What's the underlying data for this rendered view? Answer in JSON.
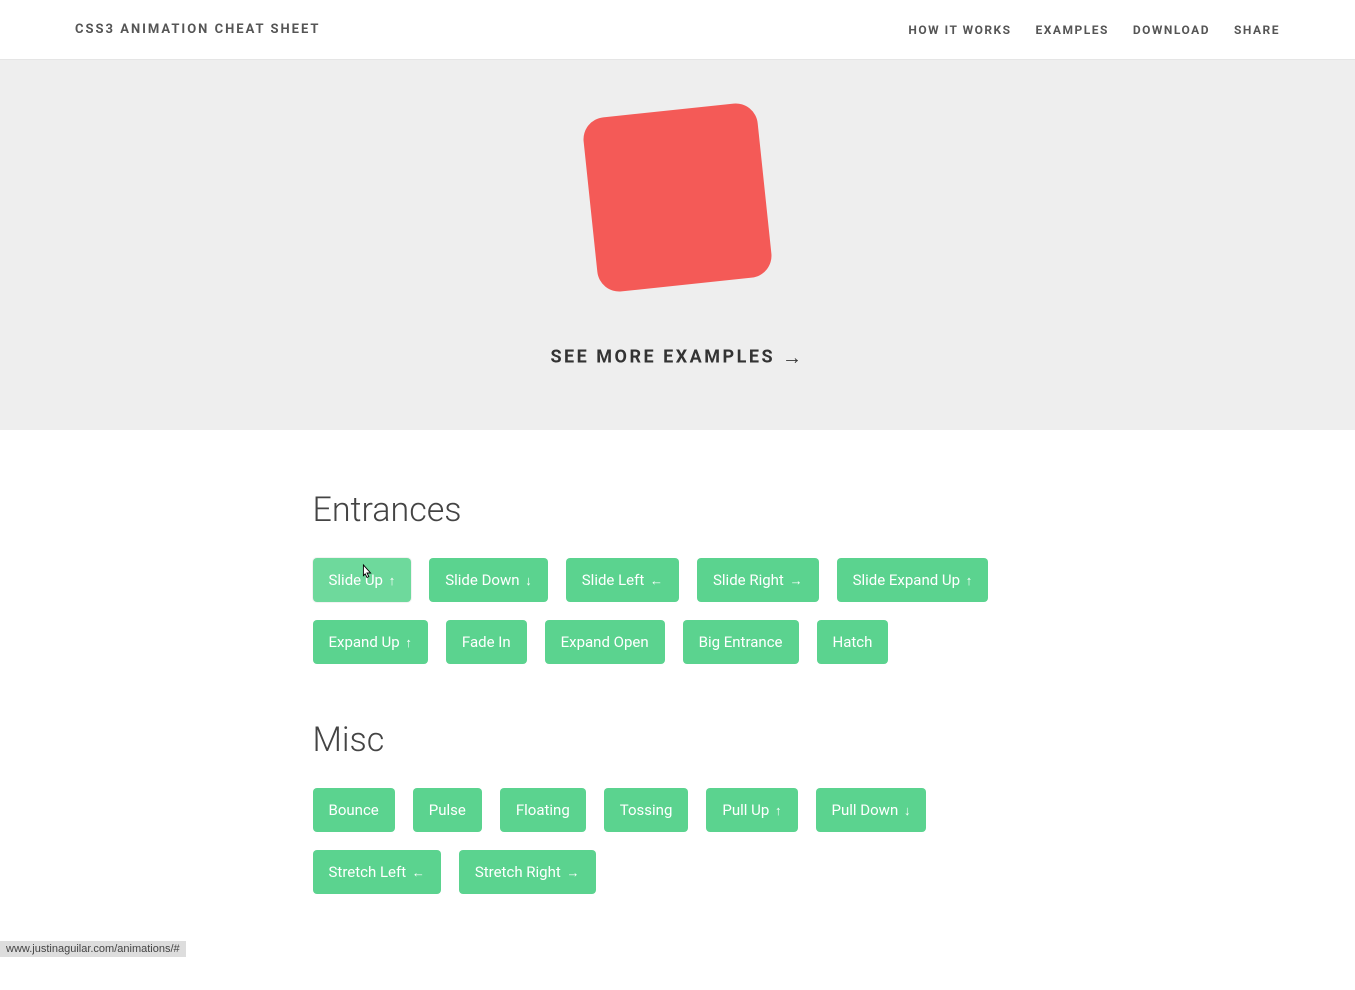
{
  "header": {
    "logo": "CSS3 ANIMATION CHEAT SHEET",
    "nav": {
      "how_it_works": "HOW IT WORKS",
      "examples": "EXAMPLES",
      "download": "DOWNLOAD",
      "share": "SHARE"
    }
  },
  "hero": {
    "see_more": "SEE MORE EXAMPLES",
    "arrow": "→"
  },
  "sections": {
    "entrances": {
      "title": "Entrances",
      "buttons": {
        "slide_up": {
          "label": "Slide Up",
          "arrow": "↑"
        },
        "slide_down": {
          "label": "Slide Down",
          "arrow": "↓"
        },
        "slide_left": {
          "label": "Slide Left",
          "arrow": "←"
        },
        "slide_right": {
          "label": "Slide Right",
          "arrow": "→"
        },
        "slide_expand_up": {
          "label": "Slide Expand Up",
          "arrow": "↑"
        },
        "expand_up": {
          "label": "Expand Up",
          "arrow": "↑"
        },
        "fade_in": {
          "label": "Fade In",
          "arrow": ""
        },
        "expand_open": {
          "label": "Expand Open",
          "arrow": ""
        },
        "big_entrance": {
          "label": "Big Entrance",
          "arrow": ""
        },
        "hatch": {
          "label": "Hatch",
          "arrow": ""
        }
      }
    },
    "misc": {
      "title": "Misc",
      "buttons": {
        "bounce": {
          "label": "Bounce",
          "arrow": ""
        },
        "pulse": {
          "label": "Pulse",
          "arrow": ""
        },
        "floating": {
          "label": "Floating",
          "arrow": ""
        },
        "tossing": {
          "label": "Tossing",
          "arrow": ""
        },
        "pull_up": {
          "label": "Pull Up",
          "arrow": "↑"
        },
        "pull_down": {
          "label": "Pull Down",
          "arrow": "↓"
        },
        "stretch_left": {
          "label": "Stretch Left",
          "arrow": "←"
        },
        "stretch_right": {
          "label": "Stretch Right",
          "arrow": "→"
        }
      }
    }
  },
  "status_bar": "www.justinaguilar.com/animations/#"
}
